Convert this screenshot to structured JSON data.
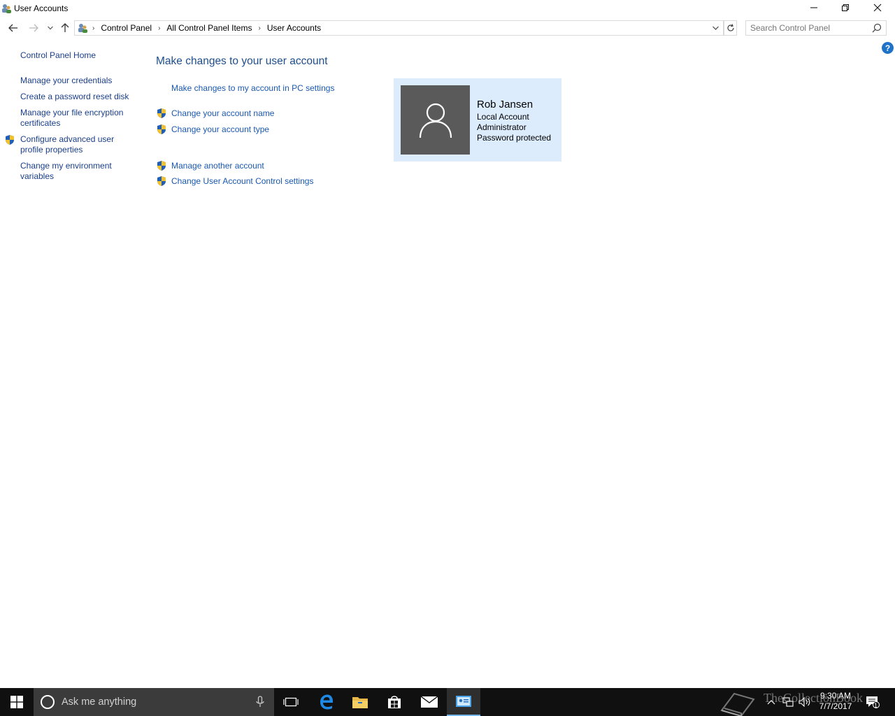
{
  "window": {
    "title": "User Accounts"
  },
  "address": {
    "crumbs": [
      "Control Panel",
      "All Control Panel Items",
      "User Accounts"
    ]
  },
  "search": {
    "placeholder": "Search Control Panel"
  },
  "help": {
    "label": "?"
  },
  "sidebar": {
    "home": "Control Panel Home",
    "items": [
      "Manage your credentials",
      "Create a password reset disk",
      "Manage your file encryption certificates",
      "Configure advanced user profile properties",
      "Change my environment variables"
    ]
  },
  "main": {
    "title": "Make changes to your user account",
    "links": [
      "Make changes to my account in PC settings",
      "Change your account name",
      "Change your account type",
      "Manage another account",
      "Change User Account Control settings"
    ]
  },
  "account": {
    "name": "Rob Jansen",
    "type": "Local Account",
    "role": "Administrator",
    "password": "Password protected"
  },
  "taskbar": {
    "search_placeholder": "Ask me anything",
    "time": "9:30 AM",
    "date": "7/7/2017",
    "notification_count": "1"
  },
  "watermark": {
    "text": "TheCollectionBook"
  },
  "colors": {
    "link": "#1a58b0",
    "title": "#1e4e8c",
    "card_bg": "#dcecfc",
    "taskbar_bg": "#101010"
  }
}
